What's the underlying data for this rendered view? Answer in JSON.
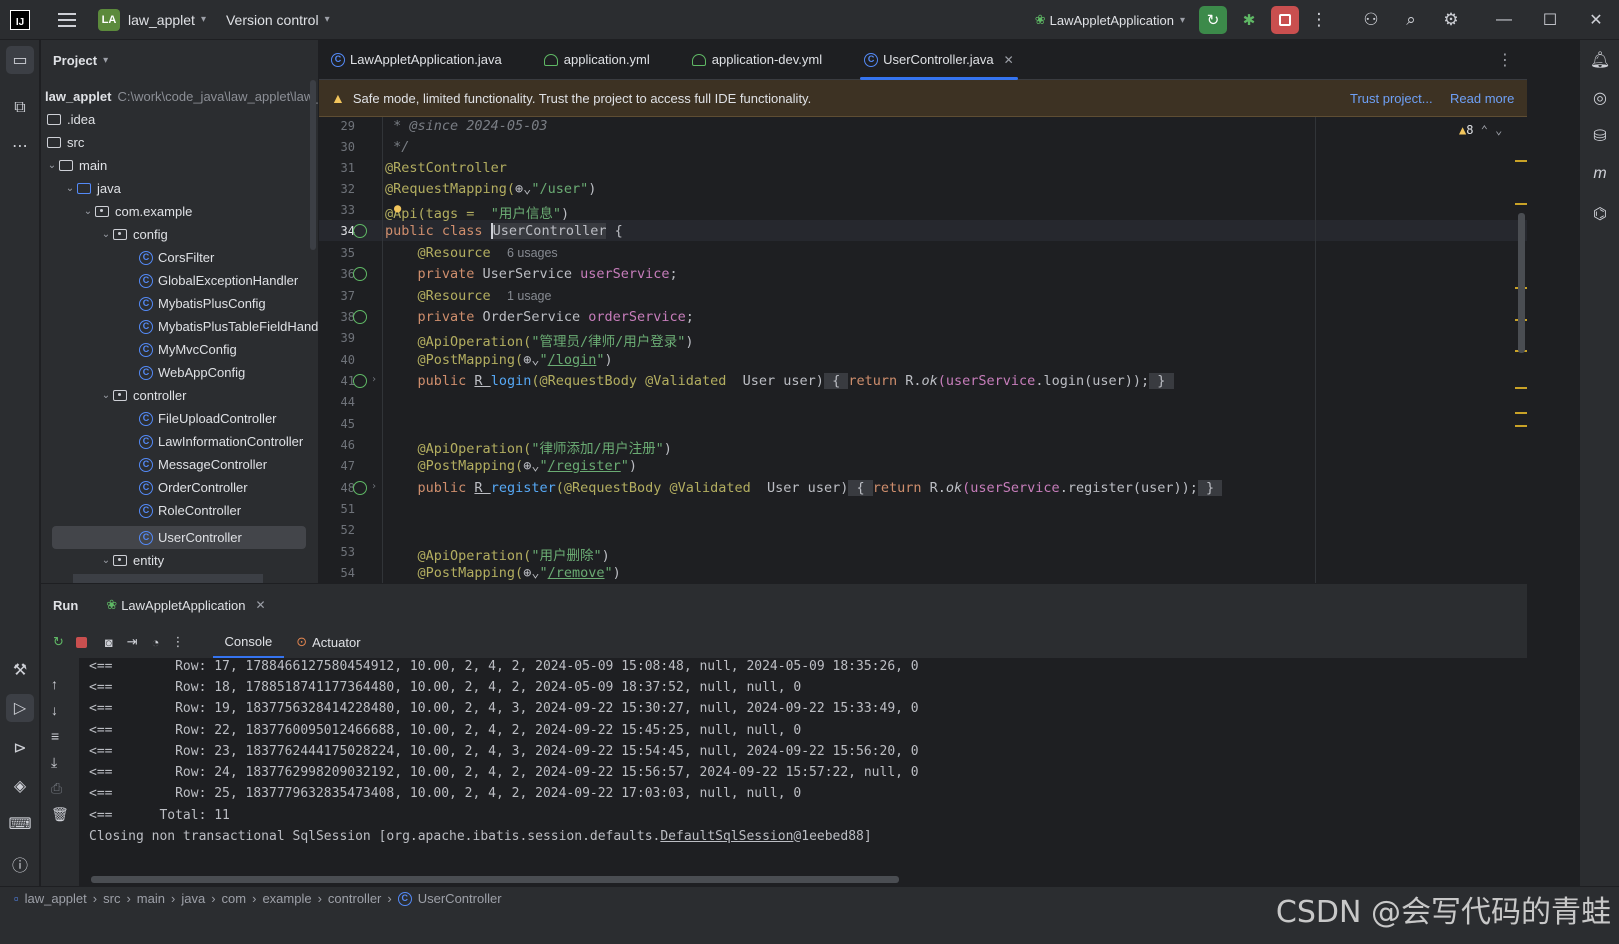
{
  "titlebar": {
    "logo_text": "IJ",
    "project_badge": "LA",
    "project_name": "law_applet",
    "vcs_label": "Version control",
    "run_config": "LawAppletApplication"
  },
  "project_panel": {
    "title": "Project",
    "root_name": "law_applet",
    "root_path": "C:\\work\\code_java\\law_applet\\law_a",
    "items": [
      {
        "label": ".idea"
      },
      {
        "label": "src"
      },
      {
        "label": "main"
      },
      {
        "label": "java"
      },
      {
        "label": "com.example"
      },
      {
        "label": "config"
      },
      {
        "label": "CorsFilter"
      },
      {
        "label": "GlobalExceptionHandler"
      },
      {
        "label": "MybatisPlusConfig"
      },
      {
        "label": "MybatisPlusTableFieldHandle"
      },
      {
        "label": "MyMvcConfig"
      },
      {
        "label": "WebAppConfig"
      },
      {
        "label": "controller"
      },
      {
        "label": "FileUploadController"
      },
      {
        "label": "LawInformationController"
      },
      {
        "label": "MessageController"
      },
      {
        "label": "OrderController"
      },
      {
        "label": "RoleController"
      },
      {
        "label": "UserController"
      },
      {
        "label": "entity"
      }
    ]
  },
  "tabs": [
    {
      "label": "LawAppletApplication.java"
    },
    {
      "label": "application.yml"
    },
    {
      "label": "application-dev.yml"
    },
    {
      "label": "UserController.java"
    }
  ],
  "banner": {
    "message": "Safe mode, limited functionality. Trust the project to access full IDE functionality.",
    "trust_link": "Trust project...",
    "read_more": "Read more"
  },
  "editor": {
    "inspection_count": "8",
    "line_numbers": [
      "29",
      "30",
      "31",
      "32",
      "33",
      "34",
      "35",
      "36",
      "37",
      "38",
      "39",
      "40",
      "41",
      "44",
      "45",
      "46",
      "47",
      "48",
      "51",
      "52",
      "53",
      "54"
    ],
    "lines": {
      "l29": "@since 2024-05-03",
      "l31": "@RestController",
      "l32a": "@RequestMapping(",
      "l32b": "\"/user\"",
      "l33a": "@Api(tags = ",
      "l33b": "\"用户信息\"",
      "l34a": "public class ",
      "l34b": "UserController",
      "l35": "@Resource",
      "l35hint": "6 usages",
      "l36a": "private ",
      "l36b": "UserService ",
      "l36c": "userService",
      "l37hint": "1 usage",
      "l38b": "OrderService ",
      "l38c": "orderService",
      "l39a": "@ApiOperation(",
      "l39b": "\"管理员/律师/用户登录\"",
      "l40a": "@PostMapping(",
      "l40b": "/login",
      "l41a": "public ",
      "l41b": "R ",
      "l41c": "login",
      "l41d": "(@RequestBody @Validated  ",
      "l41e": "User user)",
      "l41f": "return ",
      "l41g": "R.",
      "l41h": "ok",
      "l41i": "(userService",
      "l41j": ".login(user));",
      "l46b": "\"律师添加/用户注册\"",
      "l47b": "/register",
      "l48c": "register",
      "l48j": ".register(user));",
      "l53b": "\"用户删除\"",
      "l54b": "/remove"
    }
  },
  "run_panel": {
    "title": "Run",
    "config_tab": "LawAppletApplication",
    "console_tab": "Console",
    "actuator_tab": "Actuator",
    "console_lines": [
      "<==        Row: 17, 1788466127580454912, 10.00, 2, 4, 2, 2024-05-09 15:08:48, null, 2024-05-09 18:35:26, 0",
      "<==        Row: 18, 1788518741177364480, 10.00, 2, 4, 2, 2024-05-09 18:37:52, null, null, 0",
      "<==        Row: 19, 1837756328414228480, 10.00, 2, 4, 3, 2024-09-22 15:30:27, null, 2024-09-22 15:33:49, 0",
      "<==        Row: 22, 1837760095012466688, 10.00, 2, 4, 2, 2024-09-22 15:45:25, null, null, 0",
      "<==        Row: 23, 1837762444175028224, 10.00, 2, 4, 3, 2024-09-22 15:54:45, null, 2024-09-22 15:56:20, 0",
      "<==        Row: 24, 1837762998209032192, 10.00, 2, 4, 2, 2024-09-22 15:56:57, 2024-09-22 15:57:22, null, 0",
      "<==        Row: 25, 1837779632835473408, 10.00, 2, 4, 2, 2024-09-22 17:03:03, null, null, 0",
      "<==      Total: 11"
    ],
    "closing_prefix": "Closing non transactional SqlSession [org.apache.ibatis.session.defaults.",
    "closing_link": "DefaultSqlSession",
    "closing_suffix": "@1eebed88]"
  },
  "breadcrumb": {
    "items": [
      "law_applet",
      "src",
      "main",
      "java",
      "com",
      "example",
      "controller",
      "UserController"
    ]
  },
  "statusbar": {
    "watermark": "CSDN @会写代码的青蛙"
  }
}
